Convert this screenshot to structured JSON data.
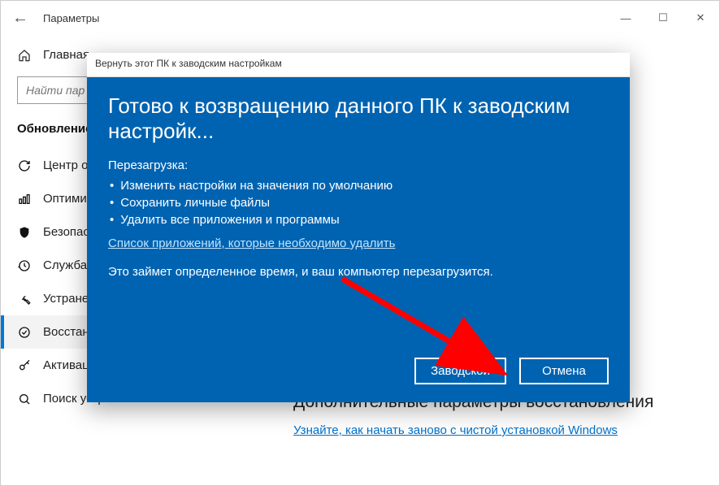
{
  "window": {
    "title": "Параметры",
    "minimize": "—",
    "maximize": "☐",
    "close": "✕",
    "back": "←"
  },
  "sidebar": {
    "home": "Главная",
    "search_placeholder": "Найти пар",
    "section": "Обновление",
    "items": [
      {
        "label": "Центр о"
      },
      {
        "label": "Оптими"
      },
      {
        "label": "Безопас"
      },
      {
        "label": "Служба"
      },
      {
        "label": "Устране"
      },
      {
        "label": "Восстан"
      },
      {
        "label": "Активация"
      },
      {
        "label": "Поиск устройства"
      }
    ]
  },
  "content": {
    "extra_heading": "Дополнительные параметры восстановления",
    "extra_link": "Узнайте, как начать заново с чистой установкой Windows"
  },
  "dialog": {
    "titlebar": "Вернуть этот ПК к заводским настройкам",
    "heading": "Готово к возвращению данного ПК к заводским настройк...",
    "reload_label": "Перезагрузка:",
    "bullets": [
      "Изменить настройки на значения по умолчанию",
      "Сохранить личные файлы",
      "Удалить все приложения и программы"
    ],
    "link": "Список приложений, которые необходимо удалить",
    "note": "Это займет определенное время, и ваш компьютер перезагрузится.",
    "btn_factory": "Заводской",
    "btn_cancel": "Отмена"
  }
}
